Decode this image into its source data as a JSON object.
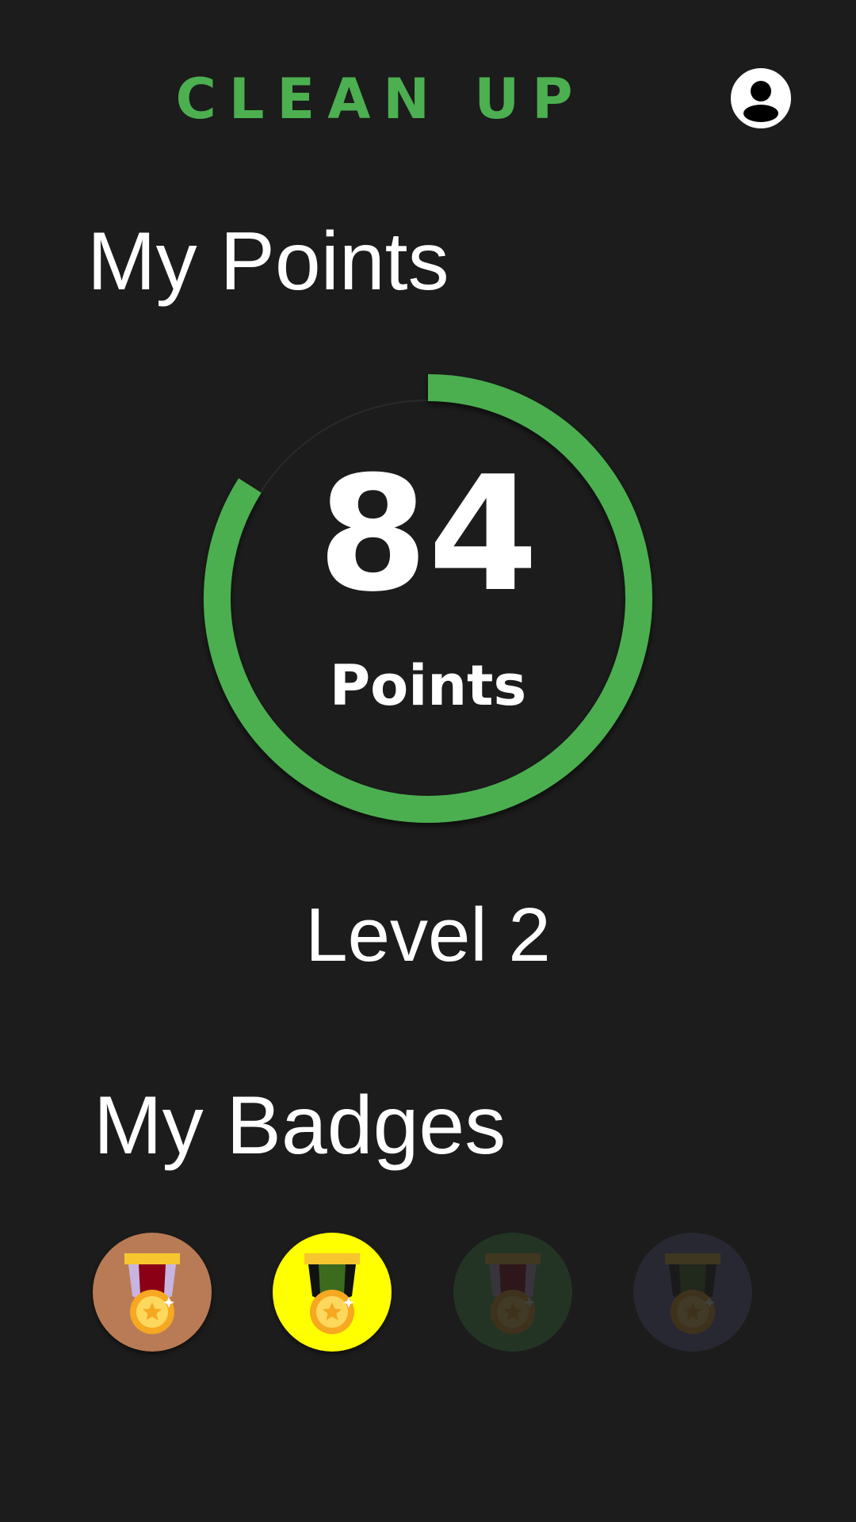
{
  "app": {
    "title": "CLEAN UP",
    "accent_color": "#4caf50",
    "profile_icon": "user-profile-icon"
  },
  "points_section": {
    "heading": "My Points",
    "points_value": "84",
    "points_unit": "Points",
    "progress_fraction": 0.84,
    "level_label": "Level 2"
  },
  "badges_section": {
    "heading": "My Badges",
    "badges": [
      {
        "icon": "medal-icon",
        "background": "#b97b56",
        "ribbon": "#8b0014",
        "ribbon_side": "#c8b4e0",
        "earned": true
      },
      {
        "icon": "medal-icon",
        "background": "#ffff00",
        "ribbon": "#3d6b1e",
        "ribbon_side": "#111111",
        "earned": true
      },
      {
        "icon": "medal-icon",
        "background": "#4caf50",
        "ribbon": "#8b0014",
        "ribbon_side": "#c8b4e0",
        "earned": false
      },
      {
        "icon": "medal-icon",
        "background": "#6a6aa8",
        "ribbon": "#3d6b1e",
        "ribbon_side": "#111111",
        "earned": false
      }
    ]
  }
}
